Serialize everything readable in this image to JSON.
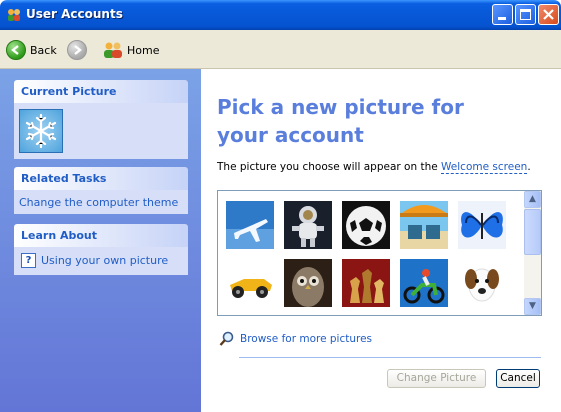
{
  "window": {
    "title": "User Accounts"
  },
  "nav": {
    "back_label": "Back",
    "home_label": "Home"
  },
  "sidebar": {
    "current_picture_title": "Current Picture",
    "related_tasks_title": "Related Tasks",
    "related_tasks": [
      "Change the computer theme"
    ],
    "learn_about_title": "Learn About",
    "learn_about": [
      "Using your own picture"
    ]
  },
  "main": {
    "heading": "Pick a new picture for your account",
    "description_prefix": "The picture you choose will appear on the ",
    "description_link": "Welcome screen",
    "description_suffix": ".",
    "pictures": [
      "airplane",
      "astronaut",
      "soccer ball",
      "beach chairs",
      "butterfly",
      "race car",
      "owl",
      "chess pieces",
      "dirt bike",
      "dog"
    ],
    "browse_label": "Browse for more pictures",
    "change_picture_label": "Change Picture",
    "cancel_label": "Cancel"
  },
  "colors": {
    "title_bar": "#0858d8",
    "sidebar": "#6f8fe0",
    "heading": "#5a7edc",
    "link": "#215dc6"
  }
}
